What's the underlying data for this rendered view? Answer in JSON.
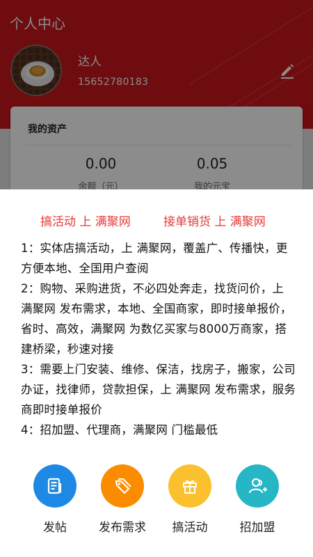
{
  "header": {
    "title": "个人中心",
    "username": "达人",
    "phone": "15652780183"
  },
  "assets": {
    "title": "我的资产",
    "items": [
      {
        "value": "0.00",
        "label": "余额（元）"
      },
      {
        "value": "0.05",
        "label": "我的元宝"
      }
    ]
  },
  "sheet": {
    "promos": [
      "搞活动 上 满聚网",
      "接单销货 上 满聚网"
    ],
    "paragraphs": [
      "1：实体店搞活动，上 满聚网，覆盖广、传播快，更方便本地、全国用户查阅",
      "2：购物、采购进货，不必四处奔走，找货问价，上 满聚网 发布需求，本地、全国商家，即时接单报价，省时、高效，满聚网 为数亿买家与8000万商家，搭建桥梁，秒速对接",
      "3：需要上门安装、维修、保洁，找房子，搬家，公司办证，找律师，贷款担保，上 满聚网 发布需求，服务商即时接单报价",
      "4：招加盟、代理商，满聚网 门槛最低"
    ],
    "actions": [
      {
        "label": "发帖",
        "icon": "post-icon",
        "color": "#1e88e5"
      },
      {
        "label": "发布需求",
        "icon": "tag-icon",
        "color": "#fb8c00"
      },
      {
        "label": "搞活动",
        "icon": "gift-icon",
        "color": "#fbc02d"
      },
      {
        "label": "招加盟",
        "icon": "add-user-icon",
        "color": "#26b6c6"
      }
    ]
  },
  "colors": {
    "header_red": "#c8161d",
    "promo_red": "#e53935"
  }
}
